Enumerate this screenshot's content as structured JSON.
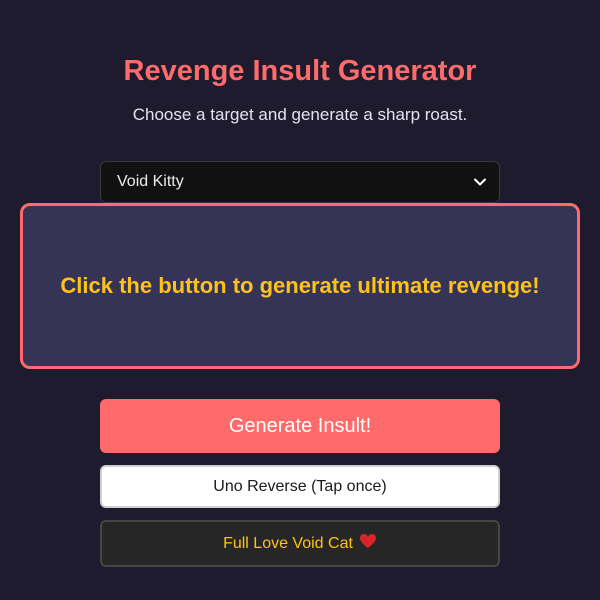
{
  "header": {
    "title": "Revenge Insult Generator",
    "subtitle": "Choose a target and generate a sharp roast."
  },
  "target_select": {
    "selected": "Void Kitty",
    "icon": "chevron-down-icon"
  },
  "output": {
    "text": "Click the button to generate ultimate revenge!"
  },
  "buttons": {
    "generate_label": "Generate Insult!",
    "uno_label": "Uno Reverse (Tap once)",
    "love_label": "Full Love Void Cat",
    "love_icon": "heart-icon"
  },
  "colors": {
    "accent": "#ff6b6b",
    "highlight": "#ffc21a",
    "background": "#1e1b2e",
    "panel": "#353356"
  }
}
